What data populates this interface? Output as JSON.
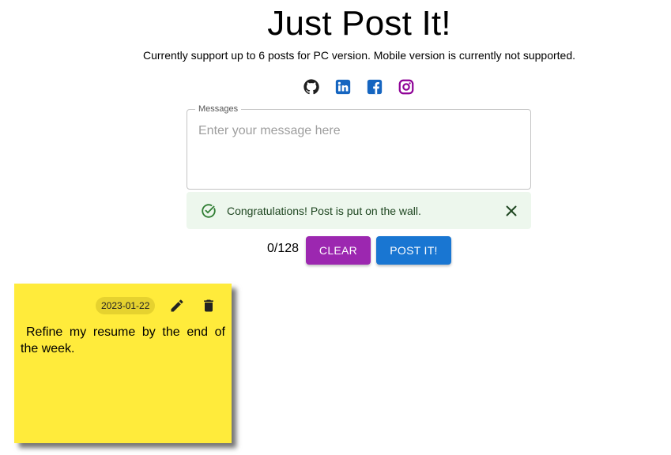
{
  "header": {
    "title": "Just Post It!",
    "subtitle": "Currently support up to 6 posts for PC version. Mobile version is currently not supported."
  },
  "socials": [
    {
      "icon": "github-icon",
      "color": "#1f1f1f"
    },
    {
      "icon": "linkedin-icon",
      "color": "#1565c0"
    },
    {
      "icon": "facebook-icon",
      "color": "#1565c0"
    },
    {
      "icon": "instagram-icon",
      "color": "#8e0096"
    }
  ],
  "composer": {
    "legend": "Messages",
    "value": "",
    "placeholder": "Enter your message here",
    "counter": "0/128",
    "clear_label": "CLEAR",
    "post_label": "POST IT!"
  },
  "alert": {
    "text": "Congratulations! Post is put on the wall.",
    "severity": "success"
  },
  "notes": [
    {
      "date": "2023-01-22",
      "text": "Refine my resume by the end of the week.",
      "color": "#ffeb3b"
    }
  ],
  "colors": {
    "clear_button": "#9c27b0",
    "post_button": "#1976d2",
    "alert_background": "#edf7ed",
    "alert_text": "#1e4620"
  }
}
